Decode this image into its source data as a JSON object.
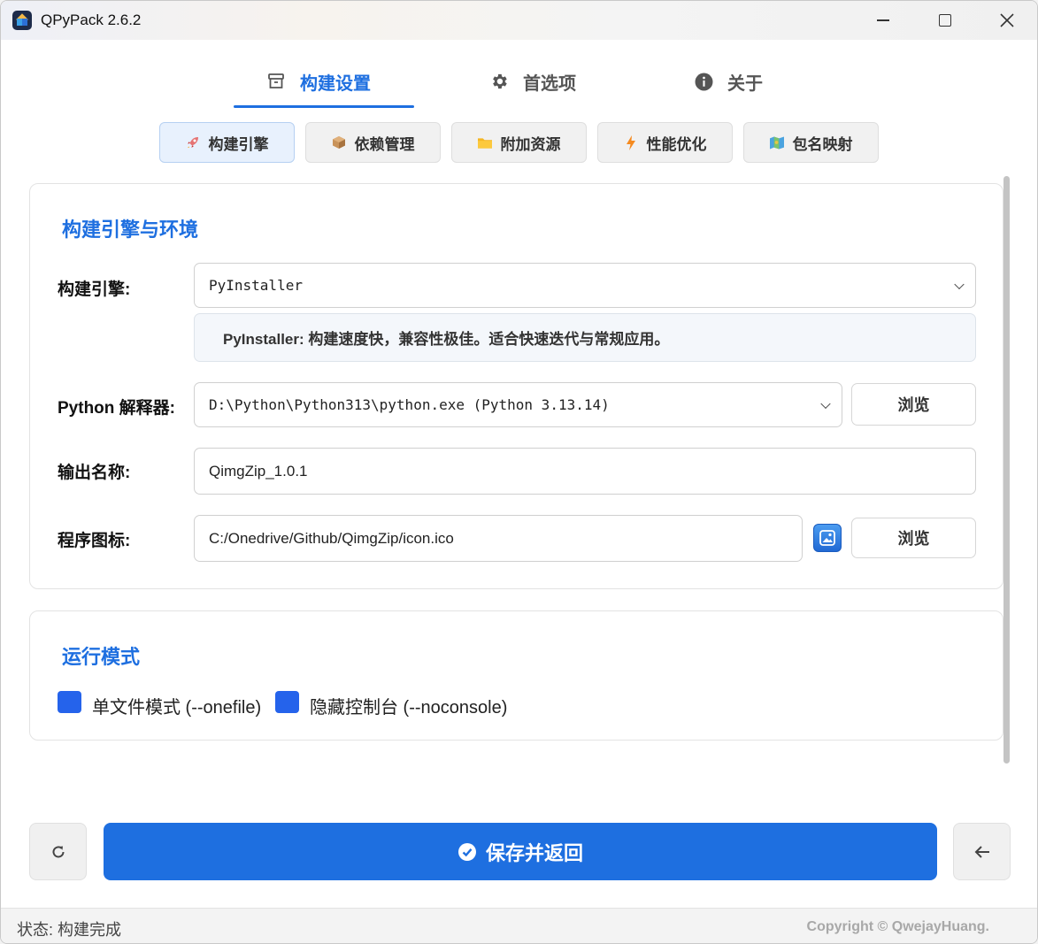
{
  "window": {
    "title": "QPyPack 2.6.2"
  },
  "top_tabs": [
    {
      "label": "构建设置",
      "icon": "archive-icon",
      "active": true
    },
    {
      "label": "首选项",
      "icon": "gear-icon",
      "active": false
    },
    {
      "label": "关于",
      "icon": "info-icon",
      "active": false
    }
  ],
  "sub_tabs": [
    {
      "label": "构建引擎",
      "icon": "rocket-icon",
      "active": true
    },
    {
      "label": "依赖管理",
      "icon": "package-icon",
      "active": false
    },
    {
      "label": "附加资源",
      "icon": "folder-icon",
      "active": false
    },
    {
      "label": "性能优化",
      "icon": "lightning-icon",
      "active": false
    },
    {
      "label": "包名映射",
      "icon": "map-icon",
      "active": false
    }
  ],
  "engine_card": {
    "title": "构建引擎与环境",
    "engine_label": "构建引擎:",
    "engine_value": "PyInstaller",
    "engine_hint": "PyInstaller: 构建速度快，兼容性极佳。适合快速迭代与常规应用。",
    "python_label": "Python 解释器:",
    "python_value": "D:\\Python\\Python313\\python.exe (Python 3.13.14)",
    "browse_label": "浏览",
    "output_label": "输出名称:",
    "output_value": "QimgZip_1.0.1",
    "icon_label": "程序图标:",
    "icon_value": "C:/Onedrive/Github/QimgZip/icon.ico"
  },
  "run_card": {
    "title": "运行模式",
    "onefile_label": "单文件模式 (--onefile)",
    "onefile_checked": true,
    "noconsole_label": "隐藏控制台 (--noconsole)",
    "noconsole_checked": true
  },
  "actions": {
    "save_label": "保存并返回"
  },
  "status": {
    "text": "状态: 构建完成",
    "copyright": "Copyright © QwejayHuang."
  },
  "colors": {
    "accent": "#1e6fe0",
    "checkbox": "#2563eb"
  }
}
